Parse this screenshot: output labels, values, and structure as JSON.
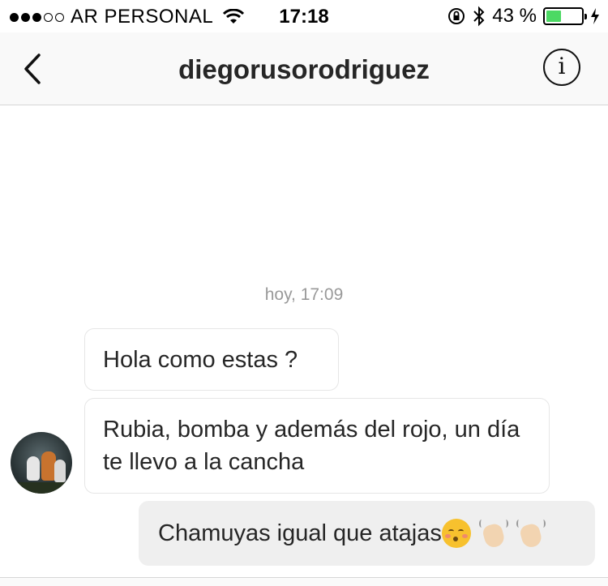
{
  "status_bar": {
    "carrier": "AR PERSONAL",
    "time": "17:18",
    "battery_percent": "43 %",
    "battery_level": 0.43,
    "icons": [
      "signal-icon",
      "wifi-icon",
      "orientation-lock-icon",
      "bluetooth-icon",
      "battery-icon",
      "charging-icon"
    ]
  },
  "header": {
    "title": "diegorusorodriguez",
    "back_icon": "chevron-left-icon",
    "info_label": "i"
  },
  "chat": {
    "timestamp": "hoy, 17:09",
    "messages": [
      {
        "direction": "incoming",
        "text": "Hola como estas ?"
      },
      {
        "direction": "incoming",
        "text": "Rubia, bomba y además del rojo, un día te llevo a la cancha"
      },
      {
        "direction": "outgoing",
        "text": "Chamuyas igual que atajas",
        "emoji": [
          "kissing-face-emoji",
          "waving-hand-emoji",
          "waving-hand-emoji"
        ]
      }
    ]
  },
  "colors": {
    "battery_fill": "#4cd964",
    "outgoing_bubble": "#efefef",
    "incoming_border": "#e6e6e6",
    "timestamp": "#999999"
  }
}
